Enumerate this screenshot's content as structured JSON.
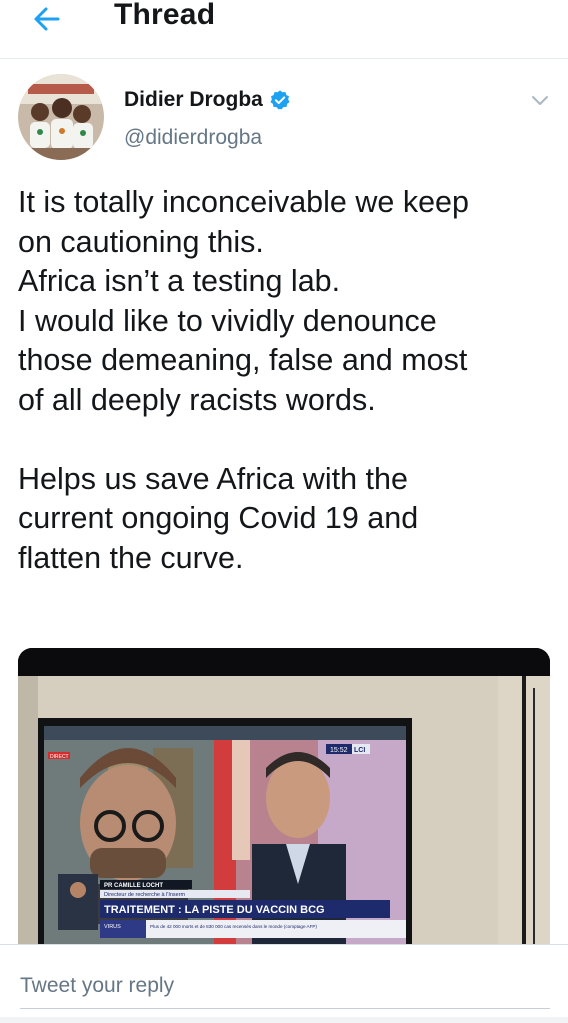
{
  "header": {
    "title": "Thread",
    "back_icon": "arrow-left-icon",
    "accent_color": "#1da1f2"
  },
  "tweet": {
    "author": {
      "display_name": "Didier Drogba",
      "handle": "@didierdrogba",
      "verified": true,
      "avatar_icon": "profile-photo"
    },
    "menu_icon": "chevron-down-icon",
    "text_lines": [
      "It is totally inconceivable we keep",
      "on cautioning this.",
      "Africa isn’t a testing lab.",
      "I would like to vividly denounce",
      "those demeaning, false and most",
      "of all deeply racists words.",
      "Helps us save Africa with the",
      "current ongoing Covid 19 and",
      "flatten the curve."
    ],
    "media": {
      "type": "video-thumbnail",
      "tv_overlay": {
        "badge": "DIRECT",
        "clock": "15:52",
        "channel": "LCI",
        "guest_name": "PR CAMILLE LOCHT",
        "guest_title": "Directeur de recherche à l'Inserm",
        "headline": "TRAITEMENT : LA PISTE DU VACCIN BCG",
        "section": "VIRUS",
        "ticker": "Plus de 42 000 morts et de 830 000 cas recensés dans le monde (comptage AFP)"
      }
    }
  },
  "reply": {
    "placeholder": "Tweet your reply"
  }
}
